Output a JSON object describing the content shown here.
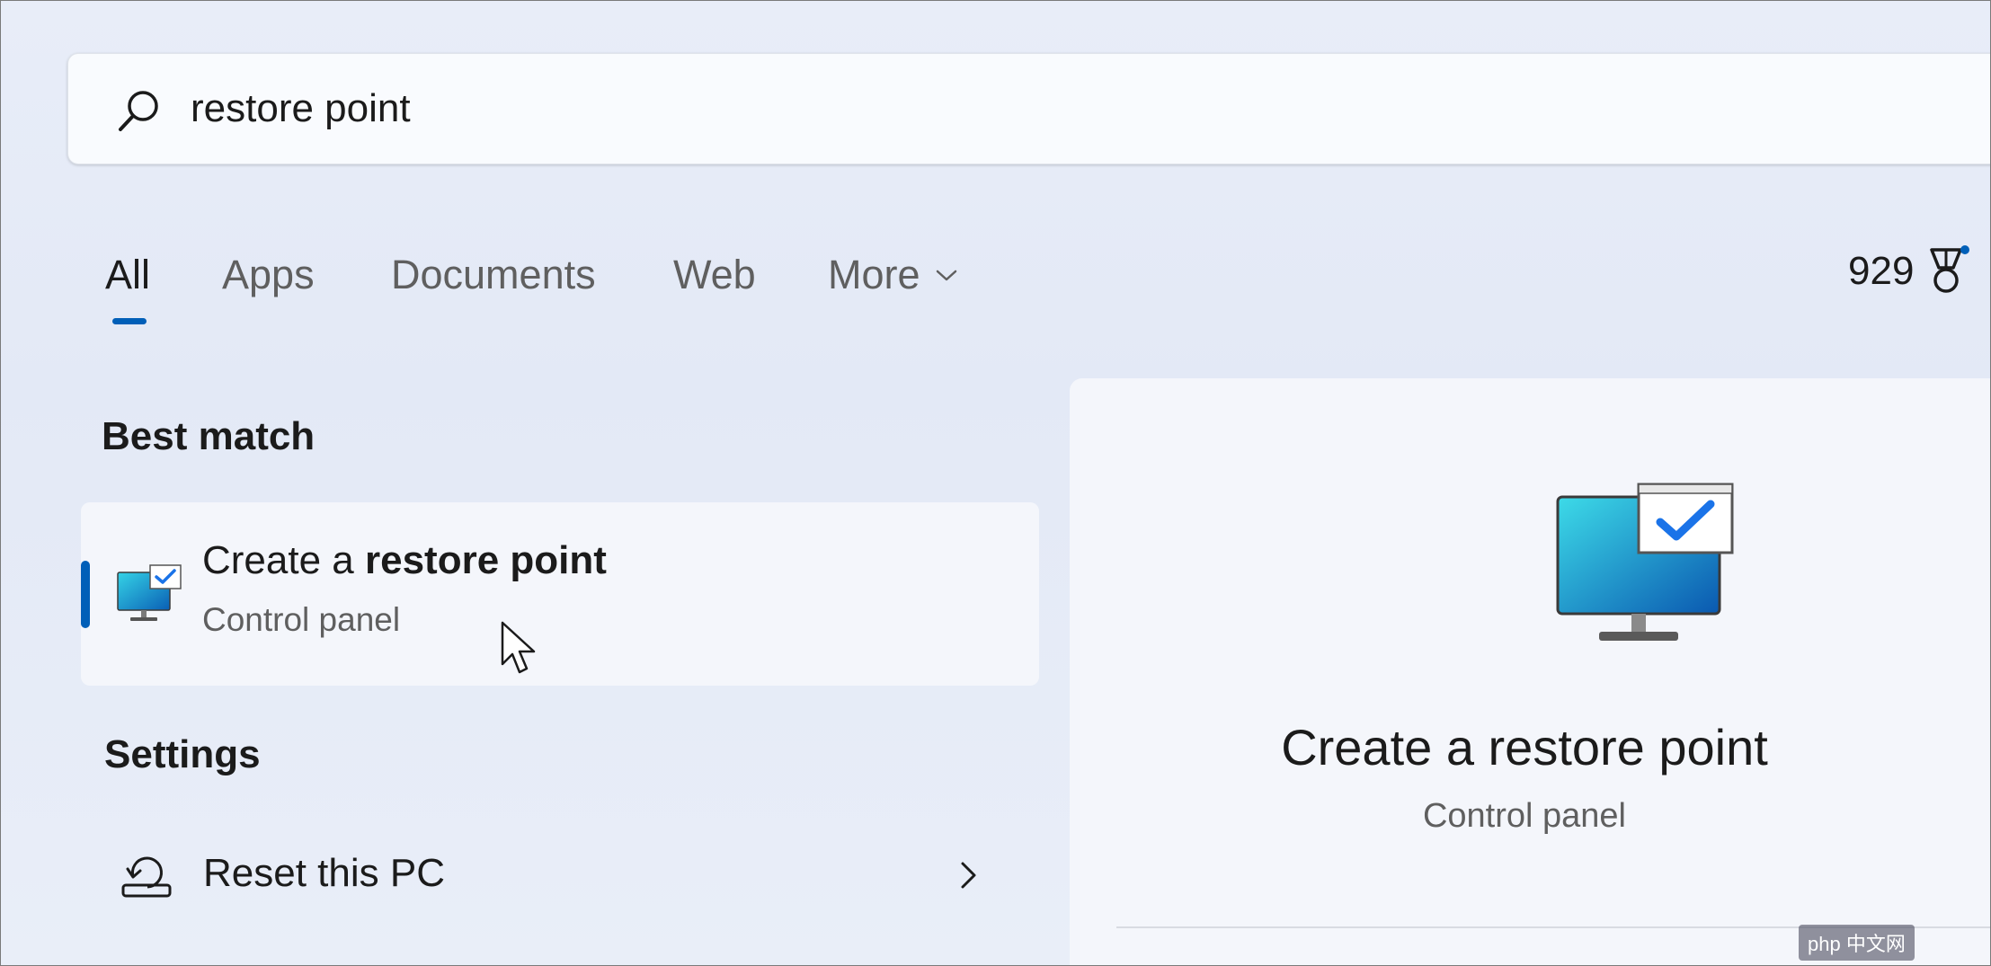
{
  "search": {
    "query": "restore point",
    "icon": "search-icon"
  },
  "tabs": [
    {
      "label": "All",
      "active": true
    },
    {
      "label": "Apps",
      "active": false
    },
    {
      "label": "Documents",
      "active": false
    },
    {
      "label": "Web",
      "active": false
    },
    {
      "label": "More",
      "active": false
    }
  ],
  "rewards": {
    "count": "929",
    "icon": "rewards-medal-icon"
  },
  "best_match": {
    "heading": "Best match",
    "title_prefix": "Create a ",
    "title_bold": "restore point",
    "subtitle": "Control panel"
  },
  "settings": {
    "heading": "Settings",
    "items": [
      {
        "label": "Reset this PC",
        "icon": "reset-pc-icon"
      }
    ]
  },
  "preview": {
    "title": "Create a restore point",
    "subtitle": "Control panel"
  },
  "watermark": "php 中文网",
  "colors": {
    "accent": "#005fb8",
    "background": "#e6ebf7",
    "card": "#f4f6fb",
    "secondary_text": "#5f5f5f"
  }
}
